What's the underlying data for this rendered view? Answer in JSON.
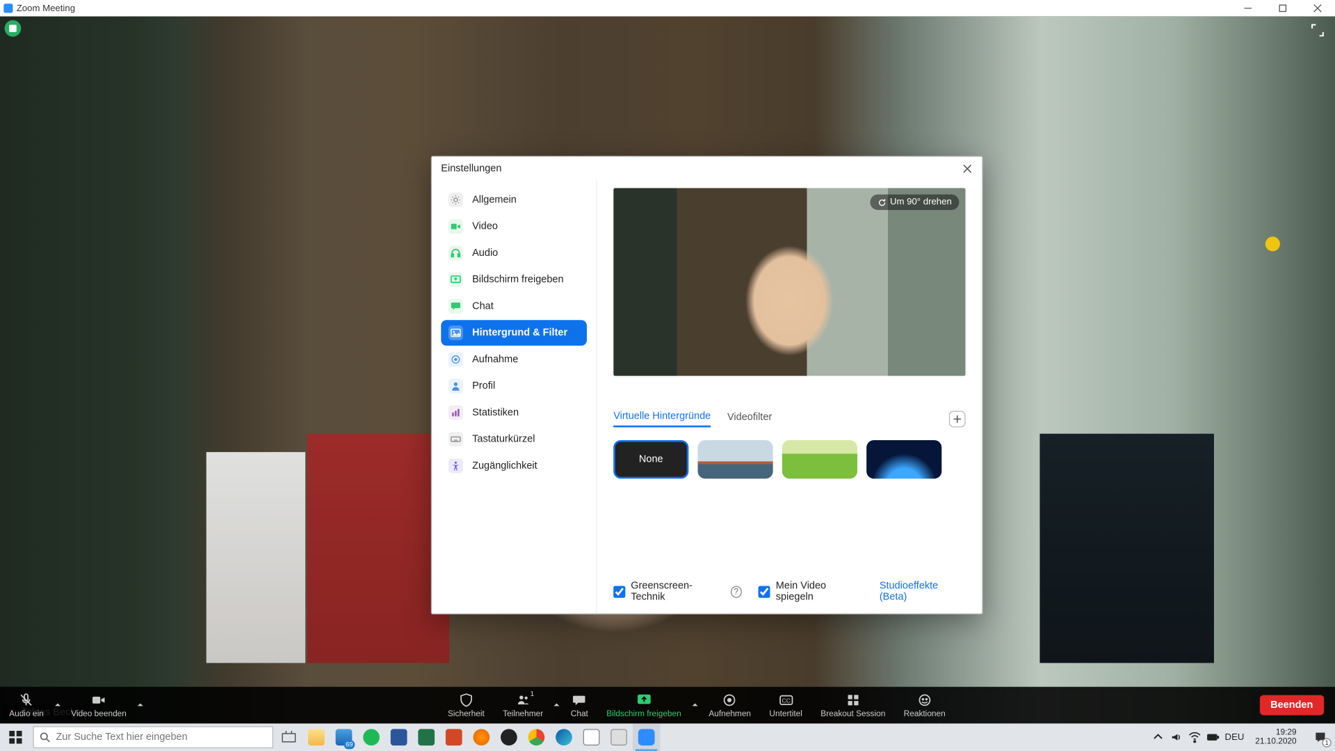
{
  "window": {
    "title": "Zoom Meeting"
  },
  "participant": {
    "name": "Tobias Becker"
  },
  "settings": {
    "title": "Einstellungen",
    "nav": {
      "general": "Allgemein",
      "video": "Video",
      "audio": "Audio",
      "share": "Bildschirm freigeben",
      "chat": "Chat",
      "background": "Hintergrund & Filter",
      "recording": "Aufnahme",
      "profile": "Profil",
      "stats": "Statistiken",
      "shortcuts": "Tastaturkürzel",
      "accessibility": "Zugänglichkeit"
    },
    "preview": {
      "rotate_label": "Um 90° drehen"
    },
    "tabs": {
      "vbg": "Virtuelle Hintergründe",
      "filters": "Videofilter"
    },
    "thumbs": {
      "none": "None"
    },
    "opts": {
      "greenscreen": "Greenscreen-Technik",
      "mirror": "Mein Video spiegeln",
      "studio": "Studioeffekte (Beta)"
    }
  },
  "controls": {
    "audio": "Audio ein",
    "video": "Video beenden",
    "security": "Sicherheit",
    "participants": "Teilnehmer",
    "participants_count": "1",
    "chat": "Chat",
    "share": "Bildschirm freigeben",
    "record": "Aufnehmen",
    "cc": "Untertitel",
    "breakout": "Breakout Session",
    "reactions": "Reaktionen",
    "end": "Beenden"
  },
  "taskbar": {
    "search_placeholder": "Zur Suche Text hier eingeben",
    "mail_badge": "69",
    "lang": "DEU",
    "time": "19:29",
    "date": "21.10.2020",
    "notif_count": "1"
  }
}
